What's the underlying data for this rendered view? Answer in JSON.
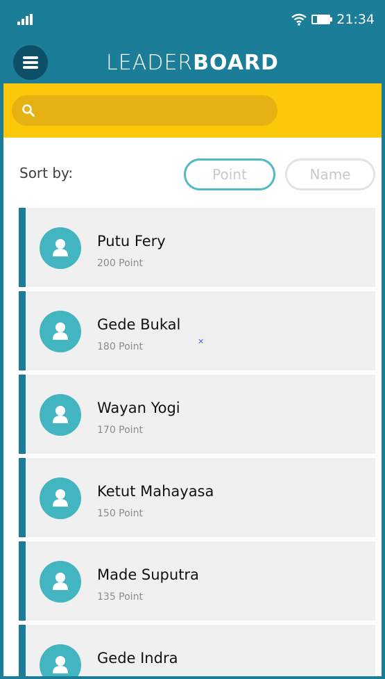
{
  "status_bar": {
    "time": "21:34",
    "icons": [
      "signal-icon",
      "wifi-icon",
      "battery-icon"
    ]
  },
  "header": {
    "title_light": "LEADER",
    "title_bold": "BOARD",
    "menu_icon": "hamburger-menu-icon"
  },
  "search": {
    "placeholder": "",
    "icon": "search-icon"
  },
  "sort": {
    "label": "Sort by:",
    "options": [
      "Point",
      "Name"
    ],
    "selected": "Point"
  },
  "players": [
    {
      "name": "Putu Fery",
      "points": "200 Point"
    },
    {
      "name": "Gede Bukal",
      "points": "180 Point"
    },
    {
      "name": "Wayan Yogi",
      "points": "170 Point"
    },
    {
      "name": "Ketut Mahayasa",
      "points": "150 Point"
    },
    {
      "name": "Made Suputra",
      "points": "135 Point"
    },
    {
      "name": "Gede Indra",
      "points": ""
    }
  ],
  "colors": {
    "primary": "#1b7d97",
    "accent": "#fdc80a",
    "avatar": "#42b5c0",
    "card_bg": "#f0f0f0"
  }
}
